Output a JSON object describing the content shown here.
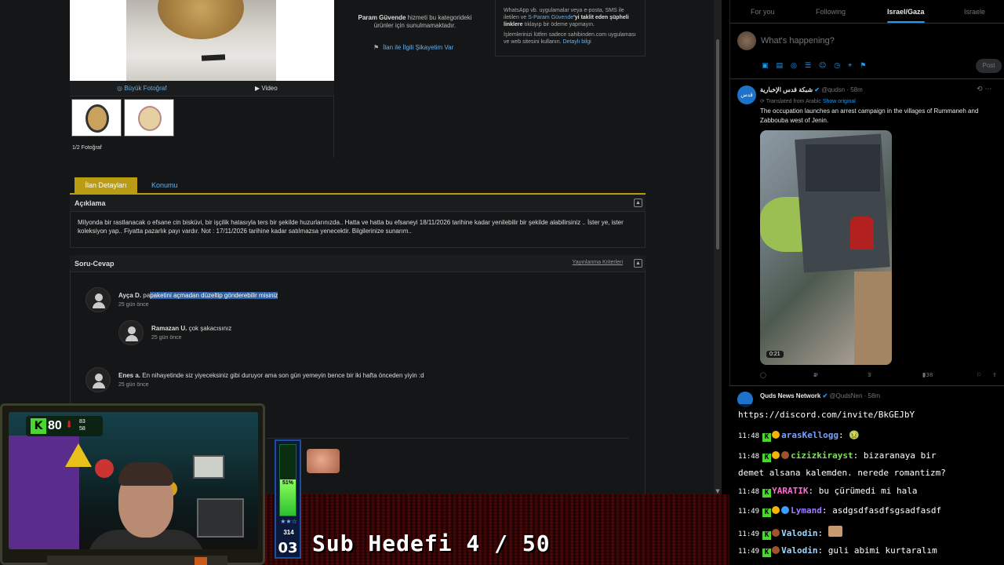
{
  "listing": {
    "photo_large_link": "Büyük Fotoğraf",
    "video_link": "Video",
    "photo_count": "1/2 Fotoğraf",
    "safe_pay_text_bold": "Param Güvende",
    "safe_pay_text_rest": "hizmeti bu kategorideki ürünler için sunulmamaktadır.",
    "report_link": "İlan ile İlgili Şikayetim Var",
    "warning_line1_a": "WhatsApp vb. uygulamalar veya e-posta, SMS ile iletilen ve",
    "warning_line1_link": "S-Param Güvende",
    "warning_line1_b": "'yi taklit eden şüpheli linklere",
    "warning_line1_c": "tıklayıp bir ödeme yapmayın.",
    "warning_line2": "İşlemlerinizi lütfen sadece sahibinden.com uygulaması ve web sitesini kullanın.",
    "warning_detail_link": "Detaylı bilgi"
  },
  "tabs": {
    "details": "İlan Detayları",
    "location": "Konumu"
  },
  "description": {
    "title": "Açıklama",
    "text": "Milyonda bir rastlanacak o efsane cin bisküvi, bir işçilik hatasıyla ters bir şekilde huzurlarınızda.. Hatta ve hatta bu efsaneyi 18/11/2026 tarihine kadar yenilebilir bir şekilde alabilirsiniz .. İster ye, ister koleksiyon yap.. Fiyatta pazarlık payı vardır. Not : 17/11/2026 tarihine kadar satılmazsa yenecektir. Bilgilerinize sunarım.."
  },
  "qa": {
    "title": "Soru-Cevap",
    "criteria_link": "Yayınlanma Kriterleri",
    "items": [
      {
        "author": "Ayça D.",
        "text_plain": "pa",
        "text_selected": "paketini açmadan düzeltip gönderebilir misiniz",
        "time": "25 gün önce"
      },
      {
        "author": "Ramazan U.",
        "text": "çok şakacısınız",
        "time": "25 gün önce"
      },
      {
        "author": "Enes a.",
        "text": "En nihayetinde siz yiyeceksiniz gibi duruyor ama son gün yemeyin bence bir iki hafta önceden yiyin :d",
        "time": "25 gün önce"
      }
    ]
  },
  "twitter": {
    "tabs": [
      "For you",
      "Following",
      "Israel/Gaza",
      "Israele"
    ],
    "active_tab": "Israel/Gaza",
    "compose_placeholder": "What's happening?",
    "post_button": "Post",
    "tweet": {
      "avatar_text": "قدس",
      "name": "شبكة قدس الإخبارية",
      "handle": "@qudsn · 58m",
      "translated": "Translated from Arabic",
      "show_original": "Show original",
      "text": "The occupation launches an arrest campaign in the villages of Rummaneh and Zabbouba west of Jenin.",
      "video_duration": "0:21",
      "retweets": "1",
      "likes": "3",
      "views": "338"
    },
    "tweet2": {
      "name": "Quds News Network",
      "handle": "@QudsNen · 58m"
    }
  },
  "chat": {
    "url_line": "https://discord.com/invite/BkGEJbY",
    "messages": [
      {
        "time": "11:48",
        "user": "arasKellogg",
        "user_color": "#7aa0ff",
        "text": "",
        "badge_gold": false,
        "emoji": "🤢"
      },
      {
        "time": "11:48",
        "user": "cizizkirayst",
        "user_color": "#7fe05a",
        "text": "bizaranaya bir",
        "badge_gold": true,
        "emoji": ""
      },
      {
        "time": "11:48",
        "user": "YARATIK",
        "user_color": "#ff6ad5",
        "text": "bu çürümedi mi hala",
        "badge_gold": false,
        "emoji": ""
      },
      {
        "time": "11:49",
        "user": "Lymand",
        "user_color": "#a07cff",
        "text": "asdgsdfasdfsgsadfasdf",
        "badge_gold": true,
        "emoji": ""
      },
      {
        "time": "11:49",
        "user": "Valodin",
        "user_color": "#9fd8ff",
        "text": "",
        "badge_gold": false,
        "emoji": ""
      },
      {
        "time": "11:49",
        "user": "Valodin",
        "user_color": "#9fd8ff",
        "text": "guli abimi kurtaralım",
        "badge_gold": false,
        "emoji": ""
      }
    ],
    "wrap_line": "demet alsana kalemden. nerede romantizm?"
  },
  "stream": {
    "kick_score": "80",
    "kick_sub_a": "83",
    "kick_sub_b": "58",
    "sub_goal_text": "Sub Hedefi 4 / 50",
    "meter_percent": "51%",
    "meter_fraction": 0.51,
    "meter_count": "314",
    "meter_level": "03"
  }
}
